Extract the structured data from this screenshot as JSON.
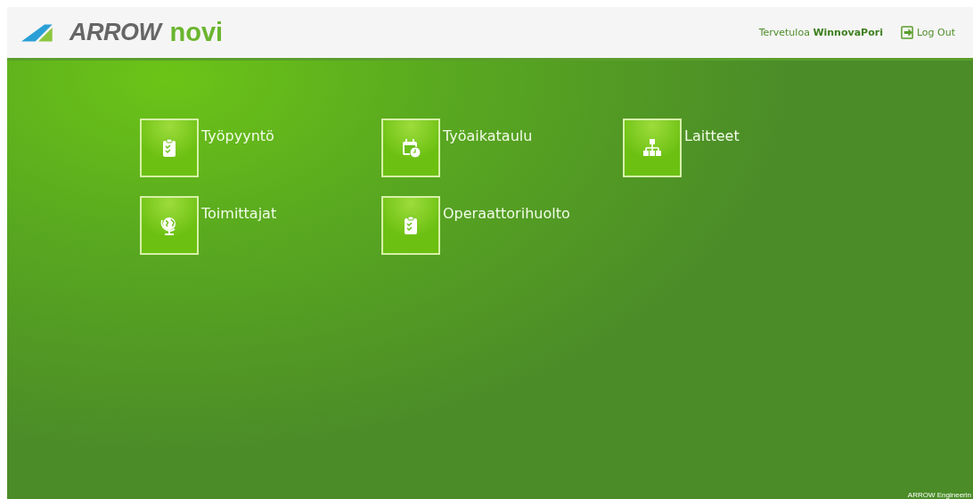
{
  "header": {
    "logo": {
      "word_1": "ARROW",
      "word_2": "novi"
    },
    "greeting": {
      "prefix": "Tervetuloa",
      "user": "WinnovaPori"
    },
    "logout": "Log Out"
  },
  "tiles": [
    {
      "label": "Työpyyntö"
    },
    {
      "label": "Työaikataulu"
    },
    {
      "label": "Laitteet"
    },
    {
      "label": "Toimittajat"
    },
    {
      "label": "Operaattorihuolto"
    }
  ],
  "footer": "ARROW Engineerin"
}
